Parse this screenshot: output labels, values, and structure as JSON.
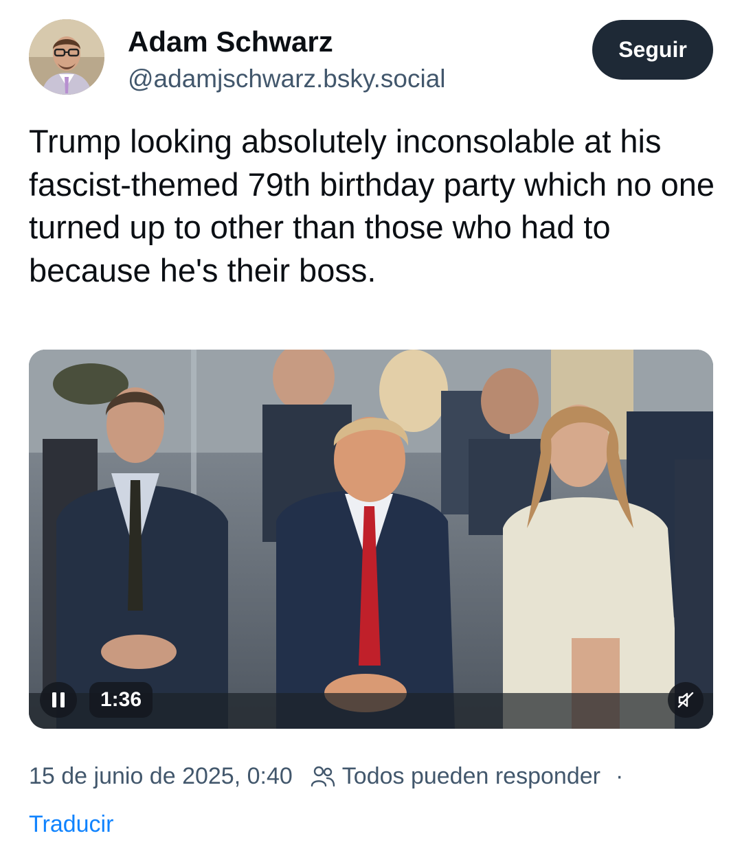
{
  "author": {
    "name": "Adam Schwarz",
    "handle": "@adamjschwarz.bsky.social",
    "avatar": "author-avatar-photo"
  },
  "follow_button": {
    "label": "Seguir"
  },
  "post": {
    "text": "Trump looking absolutely inconsolable at his fascist-themed 79th birthday party which no one turned up to other than those who had to because he's their boss."
  },
  "video": {
    "time": "1:36",
    "pause_icon": "pause-icon",
    "mute_icon": "muted-speaker-icon"
  },
  "meta": {
    "date": "15 de junio de 2025, 0:40",
    "reply_setting": "Todos pueden responder",
    "separator": "·",
    "people_icon": "people-icon"
  },
  "translate": {
    "label": "Traducir"
  },
  "colors": {
    "text": "#0b0f14",
    "secondary": "#42576c",
    "button_bg": "#1e2936",
    "link": "#1083fe"
  }
}
